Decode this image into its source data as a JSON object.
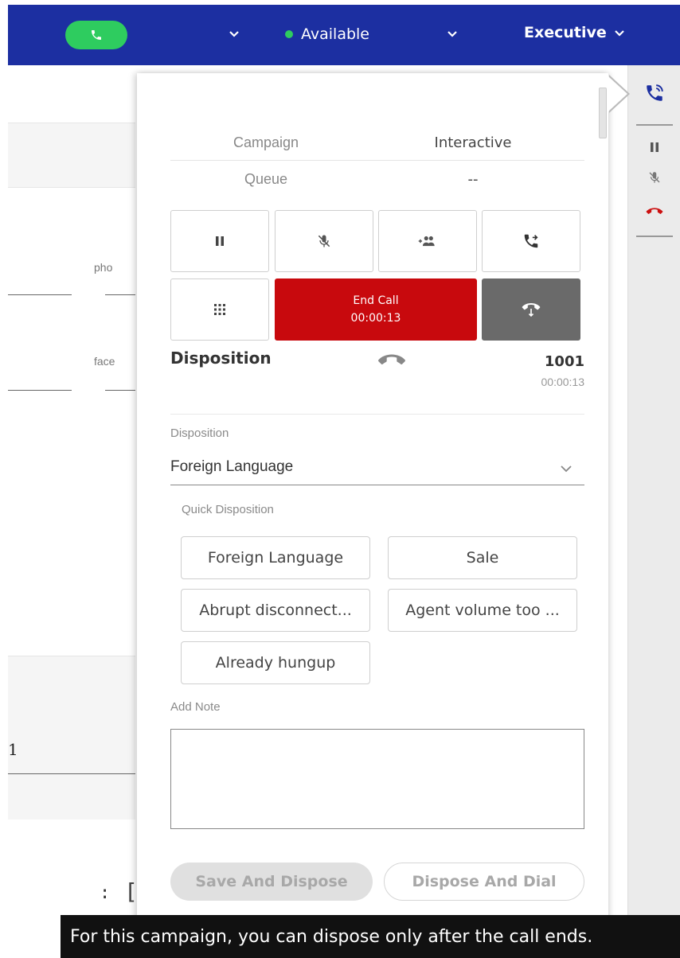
{
  "topbar": {
    "status_label": "Available",
    "profile_label": "Executive",
    "bg_color": "#1c2fa1",
    "call_pill_color": "#2ecc5f",
    "status_dot_color": "#2ecc5f"
  },
  "background": {
    "field_labels": [
      "pho",
      "face"
    ],
    "value_fragment": "1",
    "colon": ":",
    "bracket": "["
  },
  "panel": {
    "campaign_label": "Campaign",
    "campaign_value": "Interactive",
    "queue_label": "Queue",
    "queue_value": "--",
    "controls": {
      "icons": [
        "pause-icon",
        "mute-mic-icon",
        "add-participant-icon",
        "call-transfer-icon",
        "dialpad-icon",
        "hold-call-icon"
      ],
      "end_call_label": "End Call",
      "end_call_timer": "00:00:13",
      "end_call_color": "#c8090d"
    },
    "disposition_header": "Disposition",
    "call_number": "1001",
    "call_time": "00:00:13",
    "disposition_field_label": "Disposition",
    "disposition_selected": "Foreign Language",
    "quick_disposition_label": "Quick Disposition",
    "quick_dispositions": [
      "Foreign Language",
      "Sale",
      "Abrupt disconnect...",
      "Agent volume too ...",
      "Already hungup"
    ],
    "note_label": "Add Note",
    "note_value": "",
    "save_dispose_label": "Save And Dispose",
    "dispose_dial_label": "Dispose And Dial"
  },
  "rail": {
    "icons": [
      "phone-call-icon",
      "pause-icon",
      "mute-mic-icon",
      "hangup-icon"
    ]
  },
  "toast": {
    "message": "For this campaign, you can dispose only after the call ends."
  }
}
